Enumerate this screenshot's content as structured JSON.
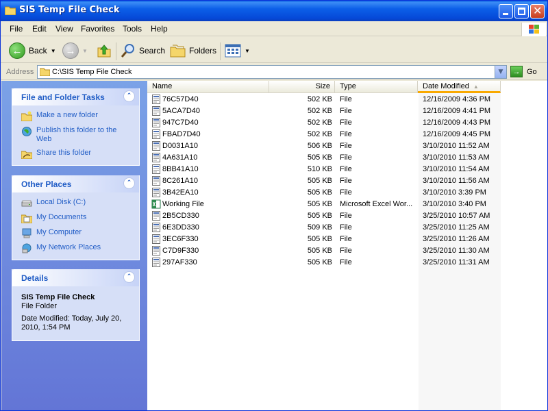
{
  "window": {
    "title": "SIS Temp File Check",
    "close_glyph": "✕"
  },
  "menu": [
    "File",
    "Edit",
    "View",
    "Favorites",
    "Tools",
    "Help"
  ],
  "toolbar": {
    "back_label": "Back",
    "search_label": "Search",
    "folders_label": "Folders"
  },
  "address": {
    "label": "Address",
    "path": "C:\\SIS Temp File Check",
    "go_label": "Go"
  },
  "tasks_panel": {
    "title": "File and Folder Tasks",
    "items": [
      {
        "label": "Make a new folder",
        "icon": "new-folder-icon"
      },
      {
        "label": "Publish this folder to the Web",
        "icon": "publish-web-icon"
      },
      {
        "label": "Share this folder",
        "icon": "share-folder-icon"
      }
    ]
  },
  "places_panel": {
    "title": "Other Places",
    "items": [
      {
        "label": "Local Disk (C:)",
        "icon": "local-disk-icon"
      },
      {
        "label": "My Documents",
        "icon": "my-documents-icon"
      },
      {
        "label": "My Computer",
        "icon": "my-computer-icon"
      },
      {
        "label": "My Network Places",
        "icon": "network-places-icon"
      }
    ]
  },
  "details_panel": {
    "title": "Details",
    "name": "SIS Temp File Check",
    "kind": "File Folder",
    "modified": "Date Modified: Today, July 20, 2010, 1:54 PM"
  },
  "columns": {
    "name": "Name",
    "size": "Size",
    "type": "Type",
    "date": "Date Modified"
  },
  "files": [
    {
      "name": "76C57D40",
      "size": "502 KB",
      "type": "File",
      "date": "12/16/2009 4:36 PM",
      "icon": "file-icon"
    },
    {
      "name": "5ACA7D40",
      "size": "502 KB",
      "type": "File",
      "date": "12/16/2009 4:41 PM",
      "icon": "file-icon"
    },
    {
      "name": "947C7D40",
      "size": "502 KB",
      "type": "File",
      "date": "12/16/2009 4:43 PM",
      "icon": "file-icon"
    },
    {
      "name": "FBAD7D40",
      "size": "502 KB",
      "type": "File",
      "date": "12/16/2009 4:45 PM",
      "icon": "file-icon"
    },
    {
      "name": "D0031A10",
      "size": "506 KB",
      "type": "File",
      "date": "3/10/2010 11:52 AM",
      "icon": "file-icon"
    },
    {
      "name": "4A631A10",
      "size": "505 KB",
      "type": "File",
      "date": "3/10/2010 11:53 AM",
      "icon": "file-icon"
    },
    {
      "name": "8BB41A10",
      "size": "510 KB",
      "type": "File",
      "date": "3/10/2010 11:54 AM",
      "icon": "file-icon"
    },
    {
      "name": "8C261A10",
      "size": "505 KB",
      "type": "File",
      "date": "3/10/2010 11:56 AM",
      "icon": "file-icon"
    },
    {
      "name": "3B42EA10",
      "size": "505 KB",
      "type": "File",
      "date": "3/10/2010 3:39 PM",
      "icon": "file-icon"
    },
    {
      "name": "Working File",
      "size": "505 KB",
      "type": "Microsoft Excel Wor...",
      "date": "3/10/2010 3:40 PM",
      "icon": "excel-icon"
    },
    {
      "name": "2B5CD330",
      "size": "505 KB",
      "type": "File",
      "date": "3/25/2010 10:57 AM",
      "icon": "file-icon"
    },
    {
      "name": "6E3DD330",
      "size": "509 KB",
      "type": "File",
      "date": "3/25/2010 11:25 AM",
      "icon": "file-icon"
    },
    {
      "name": "3EC6F330",
      "size": "505 KB",
      "type": "File",
      "date": "3/25/2010 11:26 AM",
      "icon": "file-icon"
    },
    {
      "name": "C7D9F330",
      "size": "505 KB",
      "type": "File",
      "date": "3/25/2010 11:30 AM",
      "icon": "file-icon"
    },
    {
      "name": "297AF330",
      "size": "505 KB",
      "type": "File",
      "date": "3/25/2010 11:31 AM",
      "icon": "file-icon"
    }
  ],
  "colors": {
    "titlebar": "#0549d8",
    "task_link": "#215dc6",
    "sort_highlight": "#f9a900",
    "left_pane": "#7ba2e7"
  }
}
